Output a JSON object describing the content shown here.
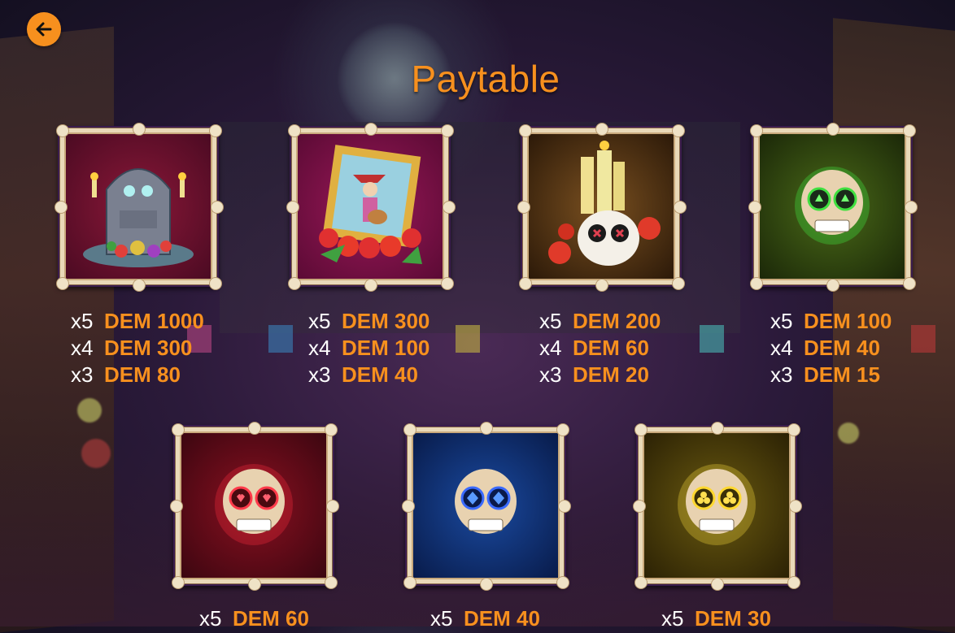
{
  "title": "Paytable",
  "back_icon": "arrow-left-icon",
  "colors": {
    "accent": "#f7901e",
    "tile_border": "#3a1c4e",
    "frame": "#e9d9b8"
  },
  "symbols": [
    {
      "icon": "tombstone-icon",
      "bg": "#6a1030",
      "pays": [
        {
          "mult": "x5",
          "amt": "DEM 1000"
        },
        {
          "mult": "x4",
          "amt": "DEM 300"
        },
        {
          "mult": "x3",
          "amt": "DEM 80"
        }
      ]
    },
    {
      "icon": "mariachi-portrait-icon",
      "bg": "#7a1045",
      "pays": [
        {
          "mult": "x5",
          "amt": "DEM 300"
        },
        {
          "mult": "x4",
          "amt": "DEM 100"
        },
        {
          "mult": "x3",
          "amt": "DEM 40"
        }
      ]
    },
    {
      "icon": "candle-skull-icon",
      "bg": "#5a3410",
      "pays": [
        {
          "mult": "x5",
          "amt": "DEM 200"
        },
        {
          "mult": "x4",
          "amt": "DEM 60"
        },
        {
          "mult": "x3",
          "amt": "DEM 20"
        }
      ]
    },
    {
      "icon": "green-skull-icon",
      "bg": "#2e4a10",
      "pays": [
        {
          "mult": "x5",
          "amt": "DEM 100"
        },
        {
          "mult": "x4",
          "amt": "DEM 40"
        },
        {
          "mult": "x3",
          "amt": "DEM 15"
        }
      ]
    },
    {
      "icon": "red-skull-icon",
      "bg": "#7a0c18",
      "pays": [
        {
          "mult": "x5",
          "amt": "DEM 60"
        }
      ]
    },
    {
      "icon": "blue-skull-icon",
      "bg": "#0c2a6a",
      "pays": [
        {
          "mult": "x5",
          "amt": "DEM 40"
        }
      ]
    },
    {
      "icon": "yellow-skull-icon",
      "bg": "#5a4a08",
      "pays": [
        {
          "mult": "x5",
          "amt": "DEM 30"
        }
      ]
    }
  ]
}
